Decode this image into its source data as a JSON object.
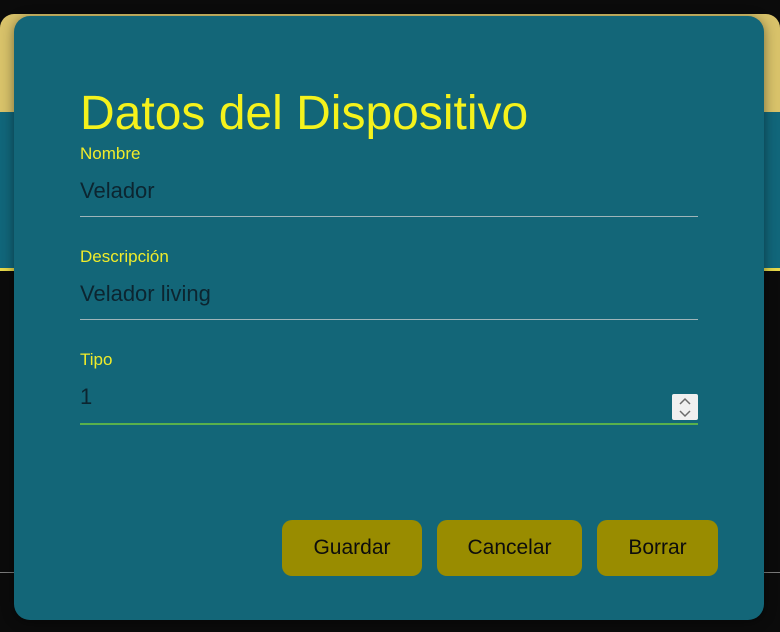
{
  "dialog": {
    "title": "Datos del Dispositivo",
    "fields": {
      "name": {
        "label": "Nombre",
        "value": "Velador"
      },
      "description": {
        "label": "Descripción",
        "value": "Velador living"
      },
      "type": {
        "label": "Tipo",
        "value": "1"
      }
    },
    "buttons": {
      "save": "Guardar",
      "cancel": "Cancelar",
      "delete": "Borrar"
    }
  },
  "colors": {
    "dialog_background": "#136678",
    "accent_text": "#f5f21c",
    "button_background": "#998c00",
    "focus_underline": "#59b04c"
  },
  "icons": {
    "spinner_up": "chevron-up-icon",
    "spinner_down": "chevron-down-icon"
  }
}
